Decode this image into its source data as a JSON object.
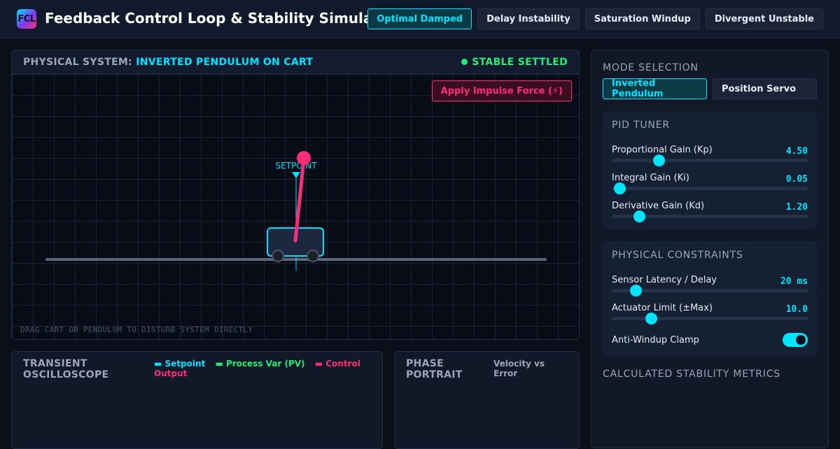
{
  "app": {
    "logo_text": "FCL",
    "title": "Feedback Control Loop & Stability Simulator"
  },
  "presets": [
    {
      "label": "Optimal Damped",
      "active": true
    },
    {
      "label": "Delay Instability",
      "active": false
    },
    {
      "label": "Saturation Windup",
      "active": false
    },
    {
      "label": "Divergent Unstable",
      "active": false
    }
  ],
  "simulation": {
    "title_prefix": "PHYSICAL SYSTEM:",
    "title_system": "INVERTED PENDULUM ON CART",
    "status": "STABLE SETTLED",
    "impulse_button": "Apply Impulse Force (⚡)",
    "setpoint_label": "SETPOINT",
    "drag_hint": "DRAG CART OR PENDULUM TO DISTURB SYSTEM DIRECTLY"
  },
  "oscilloscope": {
    "title": "TRANSIENT OSCILLOSCOPE",
    "legend": {
      "setpoint": "▬ Setpoint",
      "process_var": "▬ Process Var (PV)",
      "control_output": "▬ Control Output"
    }
  },
  "phase_portrait": {
    "title": "PHASE PORTRAIT",
    "subtitle": "Velocity vs Error"
  },
  "sidebar": {
    "mode_title": "MODE SELECTION",
    "modes": [
      {
        "label": "Inverted Pendulum",
        "active": true
      },
      {
        "label": "Position Servo",
        "active": false
      }
    ],
    "pid_title": "PID TUNER",
    "pid": [
      {
        "label": "Proportional Gain (Kp)",
        "value": "4.50",
        "fraction": 0.24
      },
      {
        "label": "Integral Gain (Ki)",
        "value": "0.05",
        "fraction": 0.04
      },
      {
        "label": "Derivative Gain (Kd)",
        "value": "1.20",
        "fraction": 0.14
      }
    ],
    "constraints_title": "PHYSICAL CONSTRAINTS",
    "constraints": [
      {
        "label": "Sensor Latency / Delay",
        "value": "20 ms",
        "fraction": 0.12
      },
      {
        "label": "Actuator Limit (±Max)",
        "value": "10.0",
        "fraction": 0.2
      }
    ],
    "anti_windup_label": "Anti-Windup Clamp",
    "anti_windup_on": true,
    "metrics_title": "CALCULATED STABILITY METRICS"
  },
  "colors": {
    "accent": "#00e5ff",
    "stable": "#22ee77",
    "danger": "#ff2d78"
  }
}
